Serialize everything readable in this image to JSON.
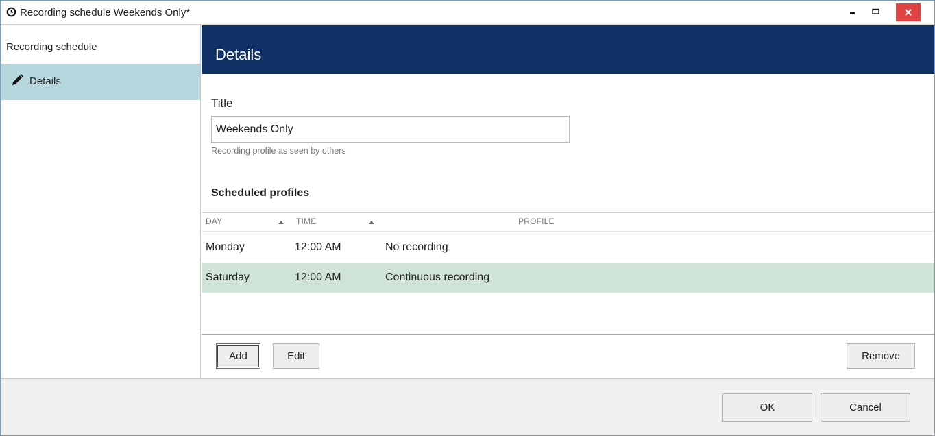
{
  "window": {
    "title": "Recording schedule Weekends Only*",
    "icon": "clock-icon",
    "controls": {
      "minimize": "minimize-icon",
      "maximize": "maximize-icon",
      "close": "close-icon"
    },
    "close_color": "#e04343"
  },
  "sidebar": {
    "header": "Recording schedule",
    "items": [
      {
        "label": "Details",
        "icon": "pencil-icon",
        "selected": true
      }
    ],
    "selected_color": "#b6d7de"
  },
  "main": {
    "banner_title": "Details",
    "banner_color": "#0f3166",
    "title_label": "Title",
    "title_value": "Weekends Only",
    "title_hint": "Recording profile as seen by others",
    "section_title": "Scheduled profiles",
    "table": {
      "columns": [
        "DAY",
        "TIME",
        "PROFILE"
      ],
      "rows": [
        {
          "day": "Monday",
          "time": "12:00 AM",
          "profile": "No recording",
          "selected": false
        },
        {
          "day": "Saturday",
          "time": "12:00 AM",
          "profile": "Continuous recording",
          "selected": true
        }
      ],
      "selected_row_color": "#cfe4d6"
    },
    "buttons": {
      "add": "Add",
      "edit": "Edit",
      "remove": "Remove"
    }
  },
  "footer": {
    "ok": "OK",
    "cancel": "Cancel"
  }
}
